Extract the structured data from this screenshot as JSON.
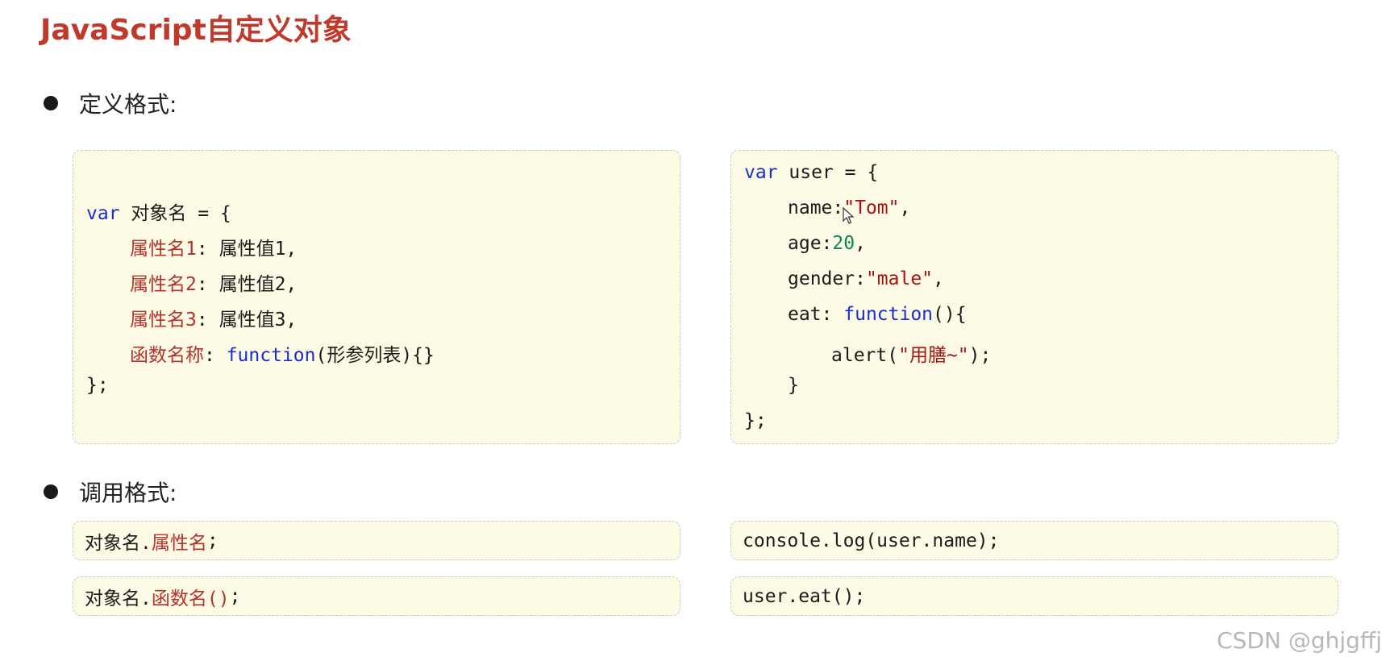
{
  "title": "JavaScript自定义对象",
  "sections": {
    "define": "定义格式:",
    "call": "调用格式:"
  },
  "define_syntax": {
    "line1_kw": "var",
    "line1_rest": " 对象名 = {",
    "props": [
      {
        "name": "属性名1",
        "sep": ": ",
        "value": "属性值1,"
      },
      {
        "name": "属性名2",
        "sep": ": ",
        "value": "属性值2,"
      },
      {
        "name": "属性名3",
        "sep": ": ",
        "value": "属性值3,"
      }
    ],
    "func_name": "函数名称",
    "func_sep": ": ",
    "func_kw": "function",
    "func_rest": "(形参列表){}",
    "close": "};"
  },
  "define_example": {
    "line1_kw": "var",
    "line1_rest": " user = {",
    "name_key": "name:",
    "name_val": "\"Tom\"",
    "name_end": ",",
    "age_key": "age:",
    "age_val": "20",
    "age_end": ",",
    "gender_key": "gender:",
    "gender_val": "\"male\"",
    "gender_end": ",",
    "eat_key": "eat: ",
    "eat_kw": "function",
    "eat_rest": "(){",
    "alert_pre": "alert(",
    "alert_str": "\"用膳~\"",
    "alert_end": ");",
    "inner_close": "}",
    "close": "};"
  },
  "call_syntax": {
    "prop_obj": "对象名.",
    "prop_name": "属性名",
    "prop_end": ";",
    "func_obj": "对象名.",
    "func_name": "函数名()",
    "func_end": ";"
  },
  "call_example": {
    "line1": "console.log(user.name);",
    "line2": "user.eat();"
  },
  "watermark": "CSDN @ghjgffj"
}
